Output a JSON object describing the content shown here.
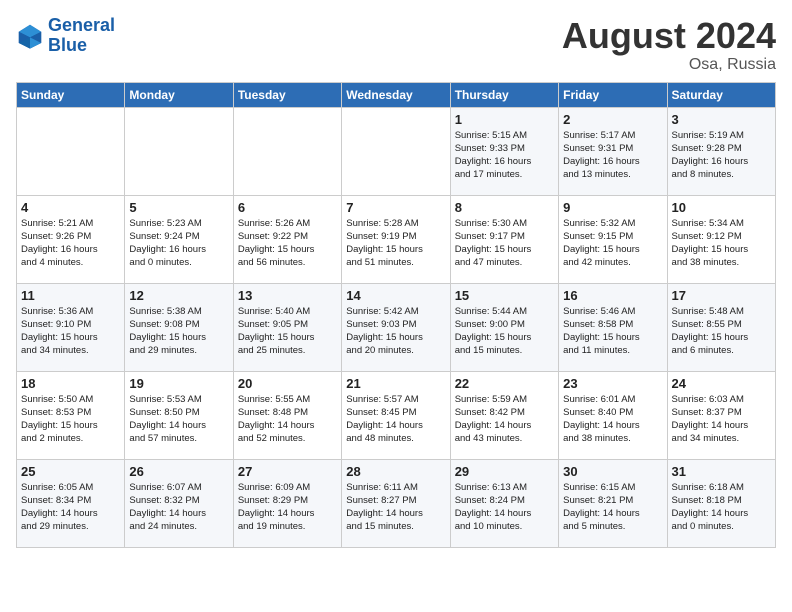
{
  "header": {
    "logo_general": "General",
    "logo_blue": "Blue",
    "month": "August 2024",
    "location": "Osa, Russia"
  },
  "weekdays": [
    "Sunday",
    "Monday",
    "Tuesday",
    "Wednesday",
    "Thursday",
    "Friday",
    "Saturday"
  ],
  "weeks": [
    [
      {
        "day": "",
        "info": ""
      },
      {
        "day": "",
        "info": ""
      },
      {
        "day": "",
        "info": ""
      },
      {
        "day": "",
        "info": ""
      },
      {
        "day": "1",
        "info": "Sunrise: 5:15 AM\nSunset: 9:33 PM\nDaylight: 16 hours\nand 17 minutes."
      },
      {
        "day": "2",
        "info": "Sunrise: 5:17 AM\nSunset: 9:31 PM\nDaylight: 16 hours\nand 13 minutes."
      },
      {
        "day": "3",
        "info": "Sunrise: 5:19 AM\nSunset: 9:28 PM\nDaylight: 16 hours\nand 8 minutes."
      }
    ],
    [
      {
        "day": "4",
        "info": "Sunrise: 5:21 AM\nSunset: 9:26 PM\nDaylight: 16 hours\nand 4 minutes."
      },
      {
        "day": "5",
        "info": "Sunrise: 5:23 AM\nSunset: 9:24 PM\nDaylight: 16 hours\nand 0 minutes."
      },
      {
        "day": "6",
        "info": "Sunrise: 5:26 AM\nSunset: 9:22 PM\nDaylight: 15 hours\nand 56 minutes."
      },
      {
        "day": "7",
        "info": "Sunrise: 5:28 AM\nSunset: 9:19 PM\nDaylight: 15 hours\nand 51 minutes."
      },
      {
        "day": "8",
        "info": "Sunrise: 5:30 AM\nSunset: 9:17 PM\nDaylight: 15 hours\nand 47 minutes."
      },
      {
        "day": "9",
        "info": "Sunrise: 5:32 AM\nSunset: 9:15 PM\nDaylight: 15 hours\nand 42 minutes."
      },
      {
        "day": "10",
        "info": "Sunrise: 5:34 AM\nSunset: 9:12 PM\nDaylight: 15 hours\nand 38 minutes."
      }
    ],
    [
      {
        "day": "11",
        "info": "Sunrise: 5:36 AM\nSunset: 9:10 PM\nDaylight: 15 hours\nand 34 minutes."
      },
      {
        "day": "12",
        "info": "Sunrise: 5:38 AM\nSunset: 9:08 PM\nDaylight: 15 hours\nand 29 minutes."
      },
      {
        "day": "13",
        "info": "Sunrise: 5:40 AM\nSunset: 9:05 PM\nDaylight: 15 hours\nand 25 minutes."
      },
      {
        "day": "14",
        "info": "Sunrise: 5:42 AM\nSunset: 9:03 PM\nDaylight: 15 hours\nand 20 minutes."
      },
      {
        "day": "15",
        "info": "Sunrise: 5:44 AM\nSunset: 9:00 PM\nDaylight: 15 hours\nand 15 minutes."
      },
      {
        "day": "16",
        "info": "Sunrise: 5:46 AM\nSunset: 8:58 PM\nDaylight: 15 hours\nand 11 minutes."
      },
      {
        "day": "17",
        "info": "Sunrise: 5:48 AM\nSunset: 8:55 PM\nDaylight: 15 hours\nand 6 minutes."
      }
    ],
    [
      {
        "day": "18",
        "info": "Sunrise: 5:50 AM\nSunset: 8:53 PM\nDaylight: 15 hours\nand 2 minutes."
      },
      {
        "day": "19",
        "info": "Sunrise: 5:53 AM\nSunset: 8:50 PM\nDaylight: 14 hours\nand 57 minutes."
      },
      {
        "day": "20",
        "info": "Sunrise: 5:55 AM\nSunset: 8:48 PM\nDaylight: 14 hours\nand 52 minutes."
      },
      {
        "day": "21",
        "info": "Sunrise: 5:57 AM\nSunset: 8:45 PM\nDaylight: 14 hours\nand 48 minutes."
      },
      {
        "day": "22",
        "info": "Sunrise: 5:59 AM\nSunset: 8:42 PM\nDaylight: 14 hours\nand 43 minutes."
      },
      {
        "day": "23",
        "info": "Sunrise: 6:01 AM\nSunset: 8:40 PM\nDaylight: 14 hours\nand 38 minutes."
      },
      {
        "day": "24",
        "info": "Sunrise: 6:03 AM\nSunset: 8:37 PM\nDaylight: 14 hours\nand 34 minutes."
      }
    ],
    [
      {
        "day": "25",
        "info": "Sunrise: 6:05 AM\nSunset: 8:34 PM\nDaylight: 14 hours\nand 29 minutes."
      },
      {
        "day": "26",
        "info": "Sunrise: 6:07 AM\nSunset: 8:32 PM\nDaylight: 14 hours\nand 24 minutes."
      },
      {
        "day": "27",
        "info": "Sunrise: 6:09 AM\nSunset: 8:29 PM\nDaylight: 14 hours\nand 19 minutes."
      },
      {
        "day": "28",
        "info": "Sunrise: 6:11 AM\nSunset: 8:27 PM\nDaylight: 14 hours\nand 15 minutes."
      },
      {
        "day": "29",
        "info": "Sunrise: 6:13 AM\nSunset: 8:24 PM\nDaylight: 14 hours\nand 10 minutes."
      },
      {
        "day": "30",
        "info": "Sunrise: 6:15 AM\nSunset: 8:21 PM\nDaylight: 14 hours\nand 5 minutes."
      },
      {
        "day": "31",
        "info": "Sunrise: 6:18 AM\nSunset: 8:18 PM\nDaylight: 14 hours\nand 0 minutes."
      }
    ]
  ]
}
